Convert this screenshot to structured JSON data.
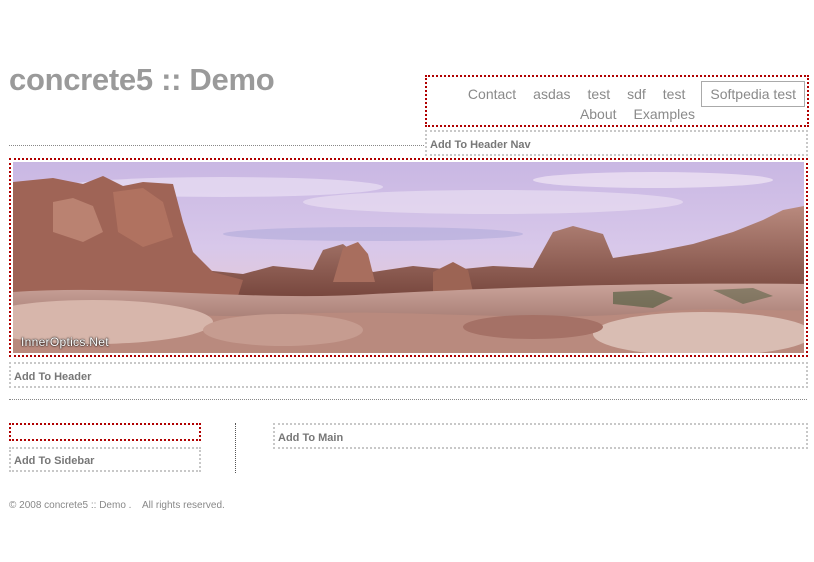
{
  "site": {
    "title": "concrete5 :: Demo"
  },
  "nav": {
    "row1": [
      "Contact",
      "asdas",
      "test",
      "sdf",
      "test"
    ],
    "boxed": "Softpedia test",
    "row2": [
      "About",
      "Examples"
    ]
  },
  "areas": {
    "header_nav": "Add To Header Nav",
    "header": "Add To Header",
    "sidebar": "Add To Sidebar",
    "main": "Add To Main"
  },
  "header_image": {
    "watermark": "InnerOptics.Net"
  },
  "footer": {
    "text": "© 2008 concrete5 :: Demo .    All rights reserved."
  },
  "colors": {
    "edit_border": "#b00000",
    "area_border": "#c8c8c8",
    "title": "#9a9a9a"
  }
}
